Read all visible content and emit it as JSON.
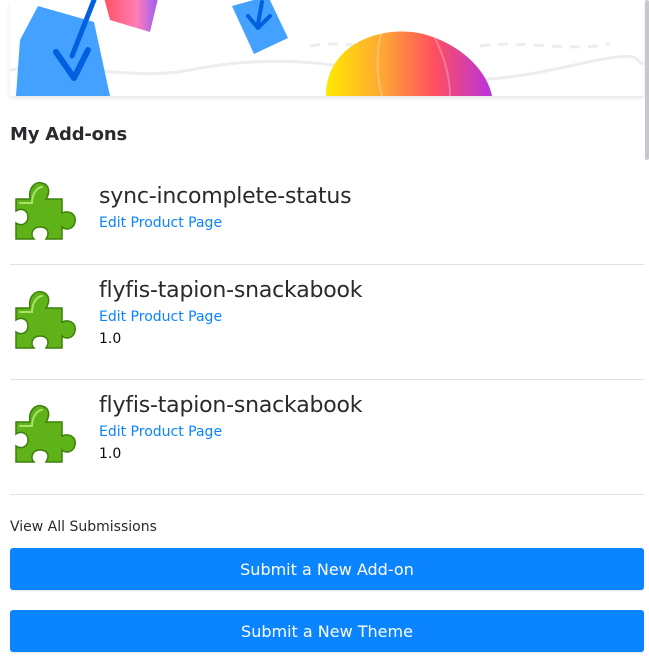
{
  "section": {
    "title": "My Add-ons"
  },
  "addons": [
    {
      "name": "sync-incomplete-status",
      "edit_label": "Edit Product Page",
      "version": "",
      "icon": "puzzle-piece-icon"
    },
    {
      "name": "flyfis-tapion-snackabook",
      "edit_label": "Edit Product Page",
      "version": "1.0",
      "icon": "puzzle-piece-icon"
    },
    {
      "name": "flyfis-tapion-snackabook",
      "edit_label": "Edit Product Page",
      "version": "1.0",
      "icon": "puzzle-piece-icon"
    }
  ],
  "footer": {
    "view_all_label": "View All Submissions",
    "submit_addon_label": "Submit a New Add-on",
    "submit_theme_label": "Submit a New Theme"
  },
  "colors": {
    "accent": "#0a84ff",
    "puzzle_green": "#5fb319",
    "divider": "#e1e1e3"
  }
}
